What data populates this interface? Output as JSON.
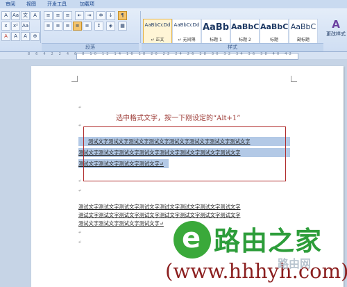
{
  "tabs": [
    "审阅",
    "视图",
    "开发工具",
    "加载项"
  ],
  "groups": {
    "paragraph": "段落",
    "styles": "样式"
  },
  "styles": [
    {
      "sample": "AaBbCcDd",
      "name": "↵ 正文",
      "selected": true,
      "size": 7
    },
    {
      "sample": "AaBbCcDd",
      "name": "↵ 无间隔",
      "selected": false,
      "size": 7
    },
    {
      "sample": "AaBb",
      "name": "标题 1",
      "selected": false,
      "size": 13
    },
    {
      "sample": "AaBbC",
      "name": "标题 2",
      "selected": false,
      "size": 11
    },
    {
      "sample": "AaBbC",
      "name": "标题",
      "selected": false,
      "size": 11
    },
    {
      "sample": "AaBbC",
      "name": "副标题",
      "selected": false,
      "size": 11
    }
  ],
  "change_styles": "更改样式",
  "ruler_numbers": "8 6 4 2 2 4 6 8 10 12 14 16 18 20 22 24 26 28 30 32 34 36 38 40 42",
  "document": {
    "title": "选中格式文字，按一下刚设定的“Alt+1”",
    "selected_lines": [
      "测试文字测试文字测试文字测试文字测试文字测试文字测试文字测试文字",
      "测试文字测试文字测试文字测试文字测试文字测试文字测试文字测试文字",
      "测试文字测试文字测试文字测试文字↵"
    ],
    "plain_lines": [
      "测试文字测试文字测试文字测试文字测试文字测试文字测试文字测试文字",
      "测试文字测试文字测试文字测试文字测试文字测试文字测试文字测试文字",
      "测试文字测试文字测试文字测试文字↵"
    ],
    "para_mark": "↵"
  },
  "watermark": {
    "logo_letter": "e",
    "brand": "路由之家",
    "url": "(www.hhhyh.com)",
    "sub": "路由网"
  }
}
